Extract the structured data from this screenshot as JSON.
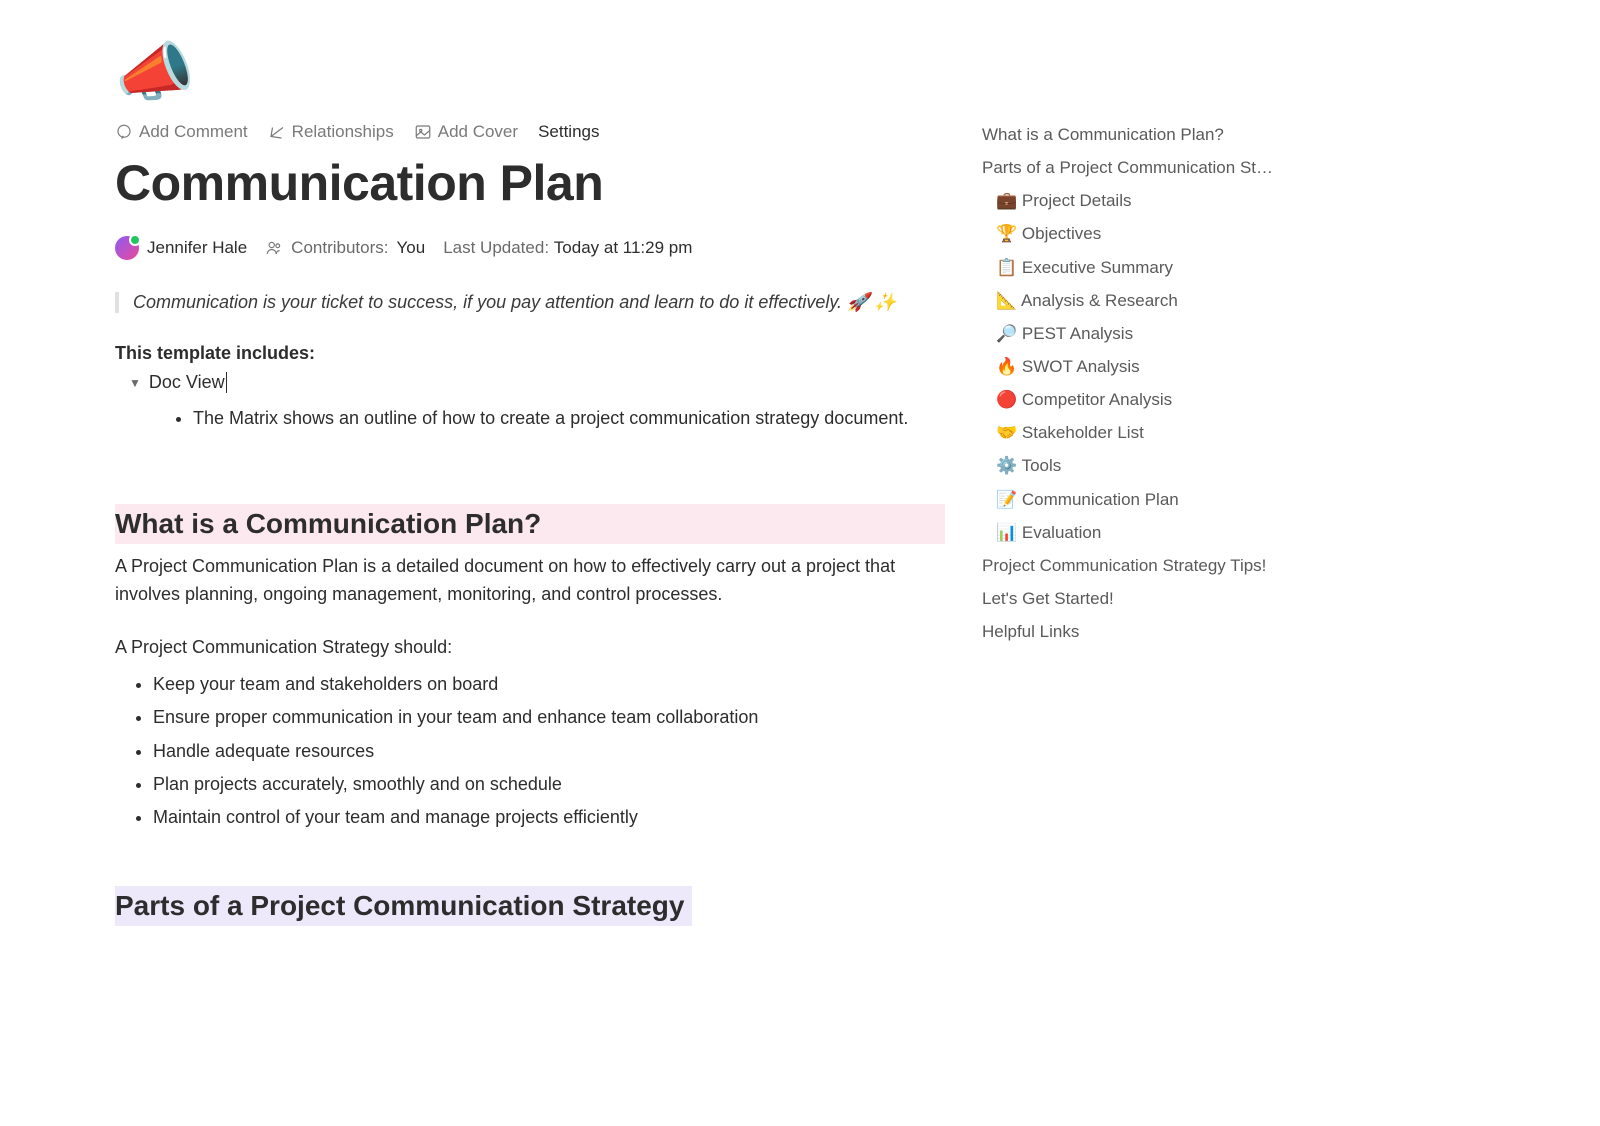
{
  "page_icon": "📣",
  "toolbar": {
    "add_comment": "Add Comment",
    "relationships": "Relationships",
    "add_cover": "Add Cover",
    "settings": "Settings"
  },
  "title": "Communication Plan",
  "meta": {
    "author": "Jennifer Hale",
    "contributors_label": "Contributors:",
    "contributors_value": "You",
    "updated_label": "Last Updated:",
    "updated_value": "Today at 11:29 pm"
  },
  "quote": "Communication is your ticket to success, if you pay attention and learn to do it effectively. 🚀 ✨",
  "template_includes_heading": "This template includes:",
  "toggle_label": "Doc View",
  "toggle_bullets": [
    "The Matrix shows an outline of how to create a project communication strategy document."
  ],
  "section_what": {
    "heading": "What is a Communication Plan?",
    "para1": "A Project Communication Plan is a detailed document on how to effectively carry out a project that involves planning, ongoing management, monitoring, and control processes.",
    "para2": "A Project Communication Strategy should:",
    "bullets": [
      "Keep your team and stakeholders on board",
      "Ensure proper communication in your team and enhance team collaboration",
      "Handle adequate resources",
      "Plan projects accurately, smoothly and on schedule",
      "Maintain control of your team and manage projects efficiently"
    ]
  },
  "section_parts": {
    "heading": "Parts of a Project Communication Strategy"
  },
  "outline": {
    "items": [
      {
        "label": "What is a Communication Plan?",
        "indent": false
      },
      {
        "label": "Parts of a Project Communication St…",
        "indent": false
      },
      {
        "label": "💼 Project Details",
        "indent": true
      },
      {
        "label": "🏆 Objectives",
        "indent": true
      },
      {
        "label": "📋 Executive Summary",
        "indent": true
      },
      {
        "label": "📐 Analysis & Research",
        "indent": true
      },
      {
        "label": "🔎 PEST Analysis",
        "indent": true
      },
      {
        "label": "🔥 SWOT Analysis",
        "indent": true
      },
      {
        "label": "🔴 Competitor Analysis",
        "indent": true
      },
      {
        "label": "🤝 Stakeholder List",
        "indent": true
      },
      {
        "label": "⚙️ Tools",
        "indent": true
      },
      {
        "label": "📝 Communication Plan",
        "indent": true
      },
      {
        "label": "📊 Evaluation",
        "indent": true
      },
      {
        "label": "Project Communication Strategy Tips!",
        "indent": false
      },
      {
        "label": "Let's Get Started!",
        "indent": false
      },
      {
        "label": "Helpful Links",
        "indent": false
      }
    ]
  }
}
